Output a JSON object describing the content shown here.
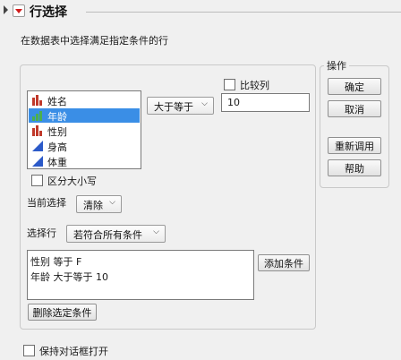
{
  "title": "行选择",
  "description": "在数据表中选择满足指定条件的行",
  "columns": [
    {
      "name": "姓名",
      "icon": "nominal-bar-icon",
      "selected": false
    },
    {
      "name": "年龄",
      "icon": "ordinal-bar-icon",
      "selected": true
    },
    {
      "name": "性别",
      "icon": "nominal-bar-icon",
      "selected": false
    },
    {
      "name": "身高",
      "icon": "continuous-triangle-icon",
      "selected": false
    },
    {
      "name": "体重",
      "icon": "continuous-triangle-icon",
      "selected": false
    }
  ],
  "condition": {
    "operator": "大于等于",
    "compare_column_label": "比较列",
    "value": "10"
  },
  "case_sensitive_label": "区分大小写",
  "current_selection": {
    "label": "当前选择",
    "value": "清除"
  },
  "select_rows": {
    "label": "选择行",
    "value": "若符合所有条件"
  },
  "conditions_list": [
    "性别 等于 F",
    "年龄 大于等于 10"
  ],
  "add_condition_label": "添加条件",
  "delete_condition_label": "删除选定条件",
  "keep_open_label": "保持对话框打开",
  "actions": {
    "legend": "操作",
    "ok": "确定",
    "cancel": "取消",
    "recall": "重新调用",
    "help": "帮助"
  },
  "colors": {
    "selection": "#3a8ee6",
    "nominal": "#c0392b",
    "ordinal": "#4caf50",
    "continuous": "#2c5ac9",
    "collapse_arrow": "#d01c1c"
  }
}
